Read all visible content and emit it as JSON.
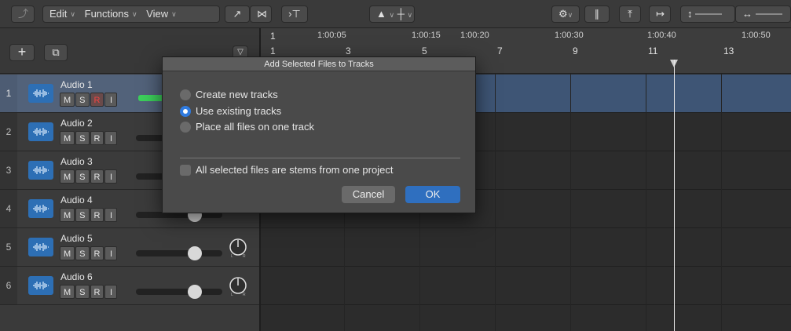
{
  "toolbar": {
    "menus": [
      {
        "label": "Edit"
      },
      {
        "label": "Functions"
      },
      {
        "label": "View"
      }
    ]
  },
  "ruler": {
    "times": [
      "1:00:05",
      "1:00:15",
      "1:00:20",
      "1:00:30",
      "1:00:40",
      "1:00:50"
    ],
    "bars": [
      "1",
      "1",
      "3",
      "5",
      "7",
      "9",
      "11",
      "13"
    ]
  },
  "tracks": [
    {
      "number": "1",
      "name": "Audio 1",
      "m": "M",
      "s": "S",
      "r": "R",
      "i": "I",
      "selected": true
    },
    {
      "number": "2",
      "name": "Audio 2",
      "m": "M",
      "s": "S",
      "r": "R",
      "i": "I",
      "selected": false
    },
    {
      "number": "3",
      "name": "Audio 3",
      "m": "M",
      "s": "S",
      "r": "R",
      "i": "I",
      "selected": false
    },
    {
      "number": "4",
      "name": "Audio 4",
      "m": "M",
      "s": "S",
      "r": "R",
      "i": "I",
      "selected": false
    },
    {
      "number": "5",
      "name": "Audio 5",
      "m": "M",
      "s": "S",
      "r": "R",
      "i": "I",
      "selected": false
    },
    {
      "number": "6",
      "name": "Audio 6",
      "m": "M",
      "s": "S",
      "r": "R",
      "i": "I",
      "selected": false
    }
  ],
  "dialog": {
    "title": "Add Selected Files to Tracks",
    "options": [
      {
        "label": "Create new tracks",
        "selected": false
      },
      {
        "label": "Use existing tracks",
        "selected": true
      },
      {
        "label": "Place all files on one track",
        "selected": false
      }
    ],
    "checkbox_label": "All selected files are stems from one project",
    "checkbox_checked": false,
    "cancel_label": "Cancel",
    "ok_label": "OK"
  },
  "colors": {
    "accent": "#2f7be0",
    "track_icon": "#2d6fb5",
    "record_armed": "#f04444",
    "meter": "#3ccf5b",
    "selected_lane": "#3e5575"
  }
}
